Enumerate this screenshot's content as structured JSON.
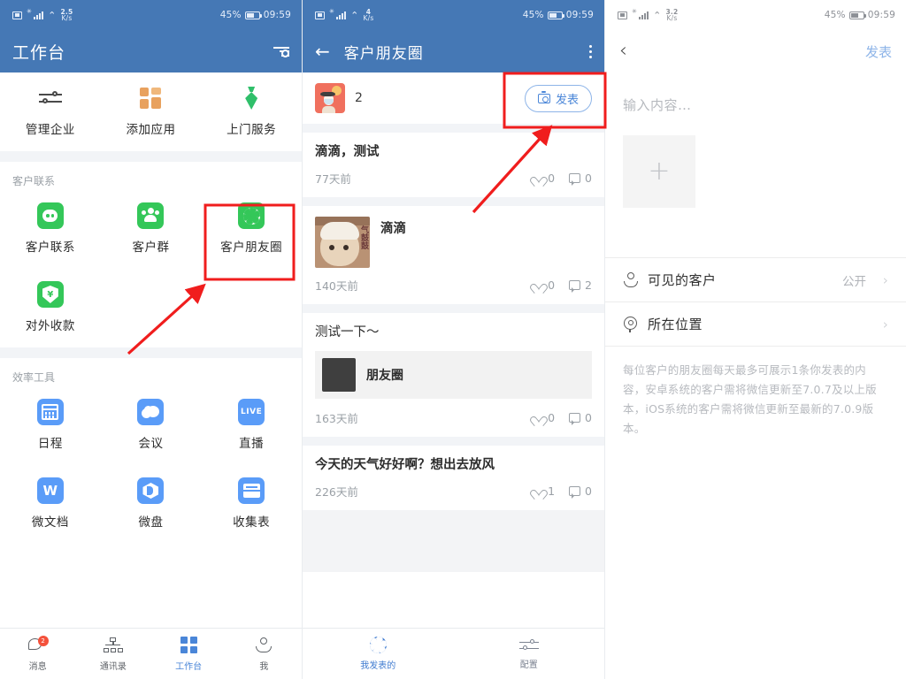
{
  "status_bar": {
    "net_speed_1": "2.5",
    "net_speed_2": "4",
    "net_speed_3": "3.2",
    "unit": "K/s",
    "battery": "45%",
    "time": "09:59"
  },
  "panel_workbench": {
    "title": "工作台",
    "menu_icon": "list-settings-icon",
    "quick_actions": [
      {
        "label": "管理企业",
        "icon": "sliders-icon"
      },
      {
        "label": "添加应用",
        "icon": "add-app-icon"
      },
      {
        "label": "上门服务",
        "icon": "tie-icon"
      }
    ],
    "sections": [
      {
        "title": "客户联系",
        "items": [
          {
            "label": "客户联系",
            "icon": "wechat-chat-icon",
            "color": "#34c759"
          },
          {
            "label": "客户群",
            "icon": "group-people-icon",
            "color": "#34c759"
          },
          {
            "label": "客户朋友圈",
            "icon": "moments-aperture-icon",
            "color": "#34c759",
            "highlighted": true
          },
          {
            "label": "对外收款",
            "icon": "shield-yuan-icon",
            "color": "#34c759"
          }
        ]
      },
      {
        "title": "效率工具",
        "items": [
          {
            "label": "日程",
            "icon": "calendar-icon",
            "color": "#5a9cf8"
          },
          {
            "label": "会议",
            "icon": "cloud-meeting-icon",
            "color": "#5a9cf8"
          },
          {
            "label": "直播",
            "icon": "live-icon",
            "color": "#5a9cf8"
          },
          {
            "label": "微文档",
            "icon": "wedoc-w-icon",
            "color": "#5a9cf8"
          },
          {
            "label": "微盘",
            "icon": "wedrive-cube-icon",
            "color": "#5a9cf8"
          },
          {
            "label": "收集表",
            "icon": "collect-form-icon",
            "color": "#5a9cf8"
          }
        ]
      }
    ],
    "tabs": [
      {
        "label": "消息",
        "icon": "message-bubble-icon",
        "badge": "2",
        "active": false
      },
      {
        "label": "通讯录",
        "icon": "org-tree-icon",
        "active": false
      },
      {
        "label": "工作台",
        "icon": "grid-icon",
        "active": true
      },
      {
        "label": "我",
        "icon": "user-icon",
        "active": false
      }
    ]
  },
  "panel_moments": {
    "title": "客户朋友圈",
    "back_icon": "arrow-left-icon",
    "menu_icon": "kebab-menu-icon",
    "me_row": {
      "avatar_name": "avatar",
      "name": "2",
      "post_button": "发表",
      "post_icon": "camera-icon"
    },
    "posts": [
      {
        "text": "滴滴，测试",
        "time": "77天前",
        "likes": "0",
        "comments": "0",
        "media": "none"
      },
      {
        "text": "滴滴",
        "time": "140天前",
        "likes": "0",
        "comments": "2",
        "media": "image",
        "image_caption": "气鼓鼓"
      },
      {
        "text": "测试一下～",
        "time": "163天前",
        "likes": "0",
        "comments": "0",
        "media": "link",
        "link_title": "朋友圈"
      },
      {
        "text": "今天的天气好好啊？想出去放风",
        "time": "226天前",
        "likes": "1",
        "comments": "0",
        "media": "none"
      }
    ],
    "tabs": [
      {
        "label": "我发表的",
        "icon": "moments-aperture-icon",
        "active": true
      },
      {
        "label": "配置",
        "icon": "sliders-icon",
        "active": false
      }
    ]
  },
  "panel_compose": {
    "back_icon": "chevron-left-icon",
    "publish_label": "发表",
    "content_placeholder": "输入内容…",
    "add_photo_icon": "plus-icon",
    "options": [
      {
        "label": "可见的客户",
        "icon": "person-icon",
        "value": "公开",
        "chevron": "›"
      },
      {
        "label": "所在位置",
        "icon": "location-pin-icon",
        "value": "",
        "chevron": "›"
      }
    ],
    "hint": "每位客户的朋友圈每天最多可展示1条你发表的内容，安卓系统的客户需将微信更新至7.0.7及以上版本，iOS系统的客户需将微信更新至最新的7.0.9版本。"
  },
  "annotations": {
    "highlight_color": "#f01d1d",
    "boxes": [
      {
        "name": "moments-app-highlight"
      },
      {
        "name": "post-button-highlight"
      }
    ],
    "arrows": [
      {
        "name": "arrow-to-moments-app"
      },
      {
        "name": "arrow-to-post-button"
      }
    ]
  }
}
